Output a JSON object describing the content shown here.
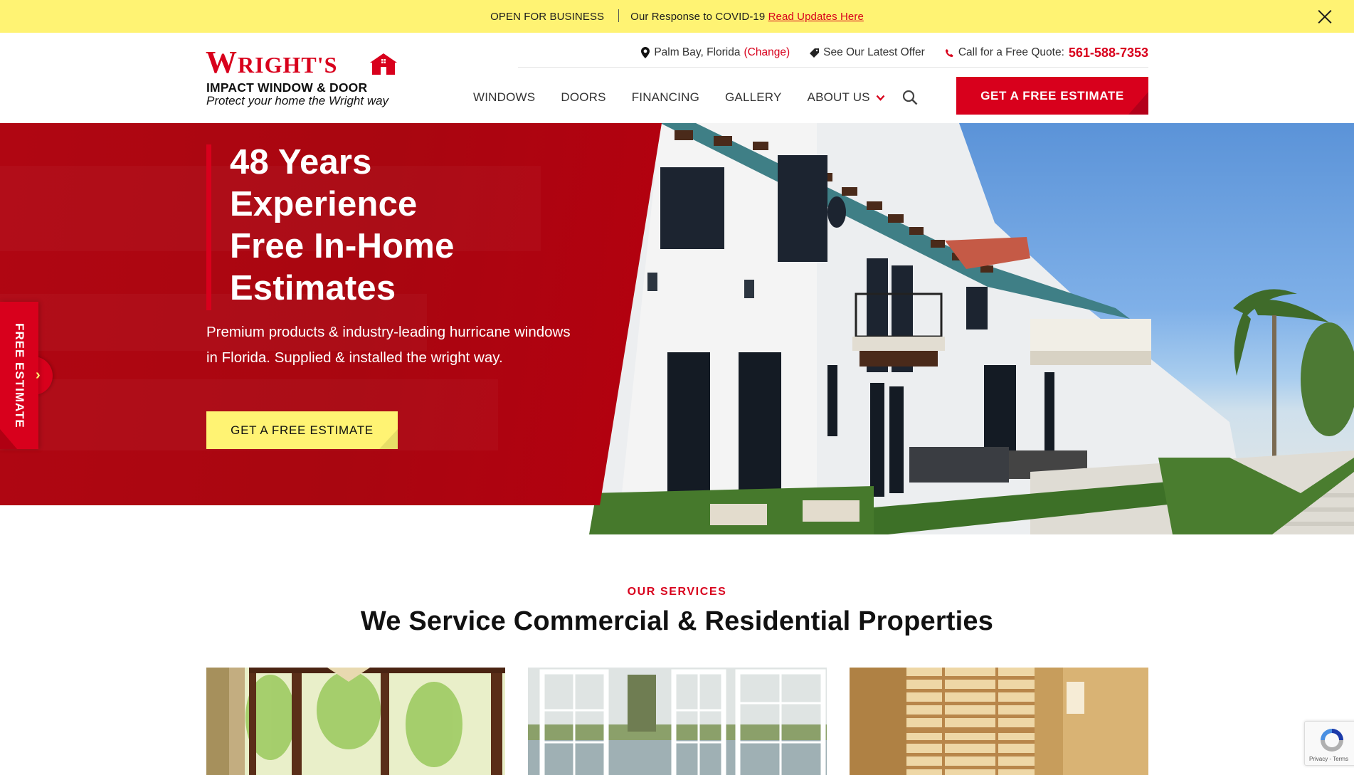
{
  "topbar": {
    "open_text": "OPEN FOR BUSINESS",
    "covid_text": "Our Response to COVID-19",
    "covid_link": "Read Updates Here",
    "close_icon": "close-icon",
    "background": "#fff373"
  },
  "header": {
    "logo": {
      "brand": "WRIGHT'S",
      "brand_initial": "W",
      "brand_rest": "RIGHT'S",
      "subtitle": "IMPACT WINDOW & DOOR",
      "tagline": "Protect your home the Wright way",
      "icon": "house-icon"
    },
    "utility": {
      "location": "Palm Bay, Florida",
      "change_label": "(Change)",
      "offer_label": "See Our Latest Offer",
      "quote_label": "Call for a Free Quote:",
      "phone": "561-588-7353"
    },
    "nav": [
      {
        "label": "WINDOWS"
      },
      {
        "label": "DOORS"
      },
      {
        "label": "FINANCING"
      },
      {
        "label": "GALLERY"
      },
      {
        "label": "ABOUT US",
        "has_dropdown": true
      }
    ],
    "search_icon": "search-icon",
    "cta_label": "GET A FREE ESTIMATE"
  },
  "hero": {
    "headline": [
      "48 Years",
      "Experience",
      "Free In-Home",
      "Estimates"
    ],
    "lede": "Premium products & industry-leading hurricane windows in Florida. Supplied & installed the wright way.",
    "button_label": "GET A FREE ESTIMATE",
    "side_tab_label": "FREE ESTIMATE",
    "side_tab_icon": "chevron-right-icon"
  },
  "services": {
    "eyebrow": "OUR SERVICES",
    "title": "We Service Commercial & Residential Properties",
    "cards": [
      {
        "image": "window-with-palm-trees"
      },
      {
        "image": "white-french-windows-lake-view"
      },
      {
        "image": "window-shades"
      }
    ]
  },
  "recaptcha": {
    "text": "Privacy - Terms"
  },
  "colors": {
    "brand_red": "#d8001c",
    "hero_red": "#ab0611",
    "accent_yellow": "#fff373",
    "text_dark": "#111111"
  }
}
